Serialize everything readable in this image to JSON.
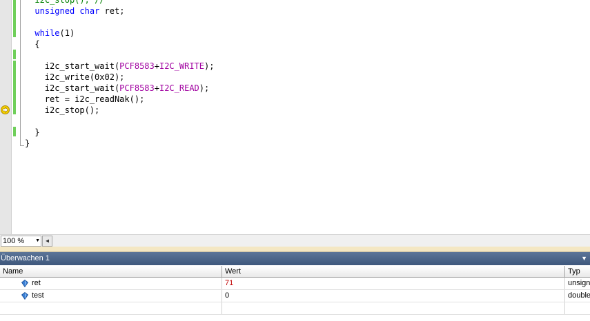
{
  "editor": {
    "lines": [
      {
        "indent": 2,
        "tokens": [
          {
            "t": "i2c_stop(); //",
            "c": "cmt"
          }
        ]
      },
      {
        "indent": 2,
        "tokens": [
          {
            "t": "unsigned",
            "c": "kw"
          },
          {
            "t": " "
          },
          {
            "t": "char",
            "c": "kw"
          },
          {
            "t": " ret;"
          }
        ]
      },
      {
        "indent": 2,
        "tokens": []
      },
      {
        "indent": 2,
        "tokens": [
          {
            "t": "while",
            "c": "kw"
          },
          {
            "t": "(1)"
          }
        ]
      },
      {
        "indent": 2,
        "tokens": [
          {
            "t": "{"
          }
        ]
      },
      {
        "indent": 4,
        "tokens": []
      },
      {
        "indent": 4,
        "tokens": [
          {
            "t": "i2c_start_wait("
          },
          {
            "t": "PCF8583",
            "c": "mac"
          },
          {
            "t": "+"
          },
          {
            "t": "I2C_WRITE",
            "c": "mac"
          },
          {
            "t": ");"
          }
        ]
      },
      {
        "indent": 4,
        "tokens": [
          {
            "t": "i2c_write(0x02);"
          }
        ]
      },
      {
        "indent": 4,
        "tokens": [
          {
            "t": "i2c_start_wait("
          },
          {
            "t": "PCF8583",
            "c": "mac"
          },
          {
            "t": "+"
          },
          {
            "t": "I2C_READ",
            "c": "mac"
          },
          {
            "t": ");"
          }
        ]
      },
      {
        "indent": 4,
        "tokens": [
          {
            "t": "ret = i2c_readNak();"
          }
        ]
      },
      {
        "indent": 4,
        "tokens": [
          {
            "t": "i2c_stop();"
          }
        ]
      },
      {
        "indent": 4,
        "tokens": []
      },
      {
        "indent": 2,
        "tokens": [
          {
            "t": "}"
          }
        ]
      },
      {
        "indent": 0,
        "tokens": [
          {
            "t": "}"
          }
        ]
      }
    ],
    "current_line_icon": "execution-arrow-icon"
  },
  "zoom": {
    "level": "100 %",
    "dropdown_icon": "chevron-down-icon",
    "scroll_left_icon": "scroll-left-arrow-icon"
  },
  "watch": {
    "title": "Überwachen 1",
    "menu_icon": "dropdown-arrow-icon",
    "columns": {
      "name": "Name",
      "value": "Wert",
      "type": "Typ"
    },
    "rows": [
      {
        "name": "ret",
        "value": "71",
        "type": "unsigned",
        "changed": true,
        "icon": "variable-icon"
      },
      {
        "name": "test",
        "value": "0",
        "type": "double",
        "changed": false,
        "icon": "variable-icon"
      }
    ]
  },
  "colors": {
    "keyword": "#0000ff",
    "macro": "#a000a0",
    "comment": "#008000",
    "changed_value": "#c00000",
    "panel_title": "#4a6388"
  }
}
